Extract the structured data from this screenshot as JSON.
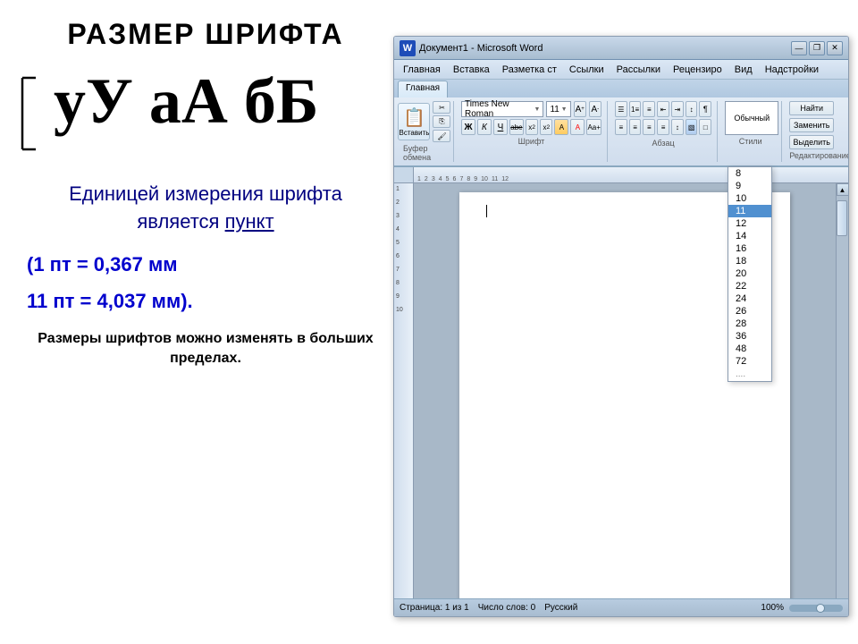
{
  "page": {
    "title": "РАЗМЕР ШРИФТА",
    "asterisk_tl": "※",
    "asterisk_bl": "※"
  },
  "font_demo": {
    "text": "уУ аА бБ"
  },
  "description": {
    "main": "Единицей измерения шрифта является ",
    "unit": "пункт",
    "formula1": "(1 пт = 0,367 мм",
    "formula2": "11 пт = 4,037 мм).",
    "note": "Размеры шрифтов можно изменять в больших пределах."
  },
  "word_window": {
    "title": "Документ1 - Microsoft Word",
    "title_icon": "W",
    "buttons": {
      "minimize": "—",
      "restore": "❐",
      "close": "✕"
    },
    "menu": {
      "items": [
        "Главная",
        "Вставка",
        "Разметка ст",
        "Ссылки",
        "Рассылки",
        "Рецензиро",
        "Вид",
        "Надстройки"
      ]
    },
    "ribbon": {
      "tabs": [
        "Главная"
      ],
      "clipboard": {
        "label": "Буфер обмена",
        "paste": "Вставить"
      },
      "font": {
        "label": "Шрифт",
        "name": "Times New Roman",
        "size": "11",
        "bold": "Ж",
        "italic": "К",
        "underline": "Ч",
        "strikethrough": "abe",
        "subscript": "x₂",
        "grow": "A",
        "shrink": "A",
        "clear": "A"
      },
      "paragraph": {
        "label": "Абзац"
      },
      "styles": {
        "label": "Стили"
      },
      "editing": {
        "label": "Редактирование"
      }
    },
    "font_dropdown": {
      "sizes": [
        "8",
        "9",
        "10",
        "11",
        "12",
        "14",
        "16",
        "18",
        "20",
        "22",
        "24",
        "26",
        "28",
        "36",
        "48",
        "72"
      ],
      "selected": "11",
      "dots": "...."
    },
    "status": {
      "page": "Страница: 1 из 1",
      "words": "Число слов: 0",
      "lang": "Русский",
      "zoom": "100%"
    }
  }
}
